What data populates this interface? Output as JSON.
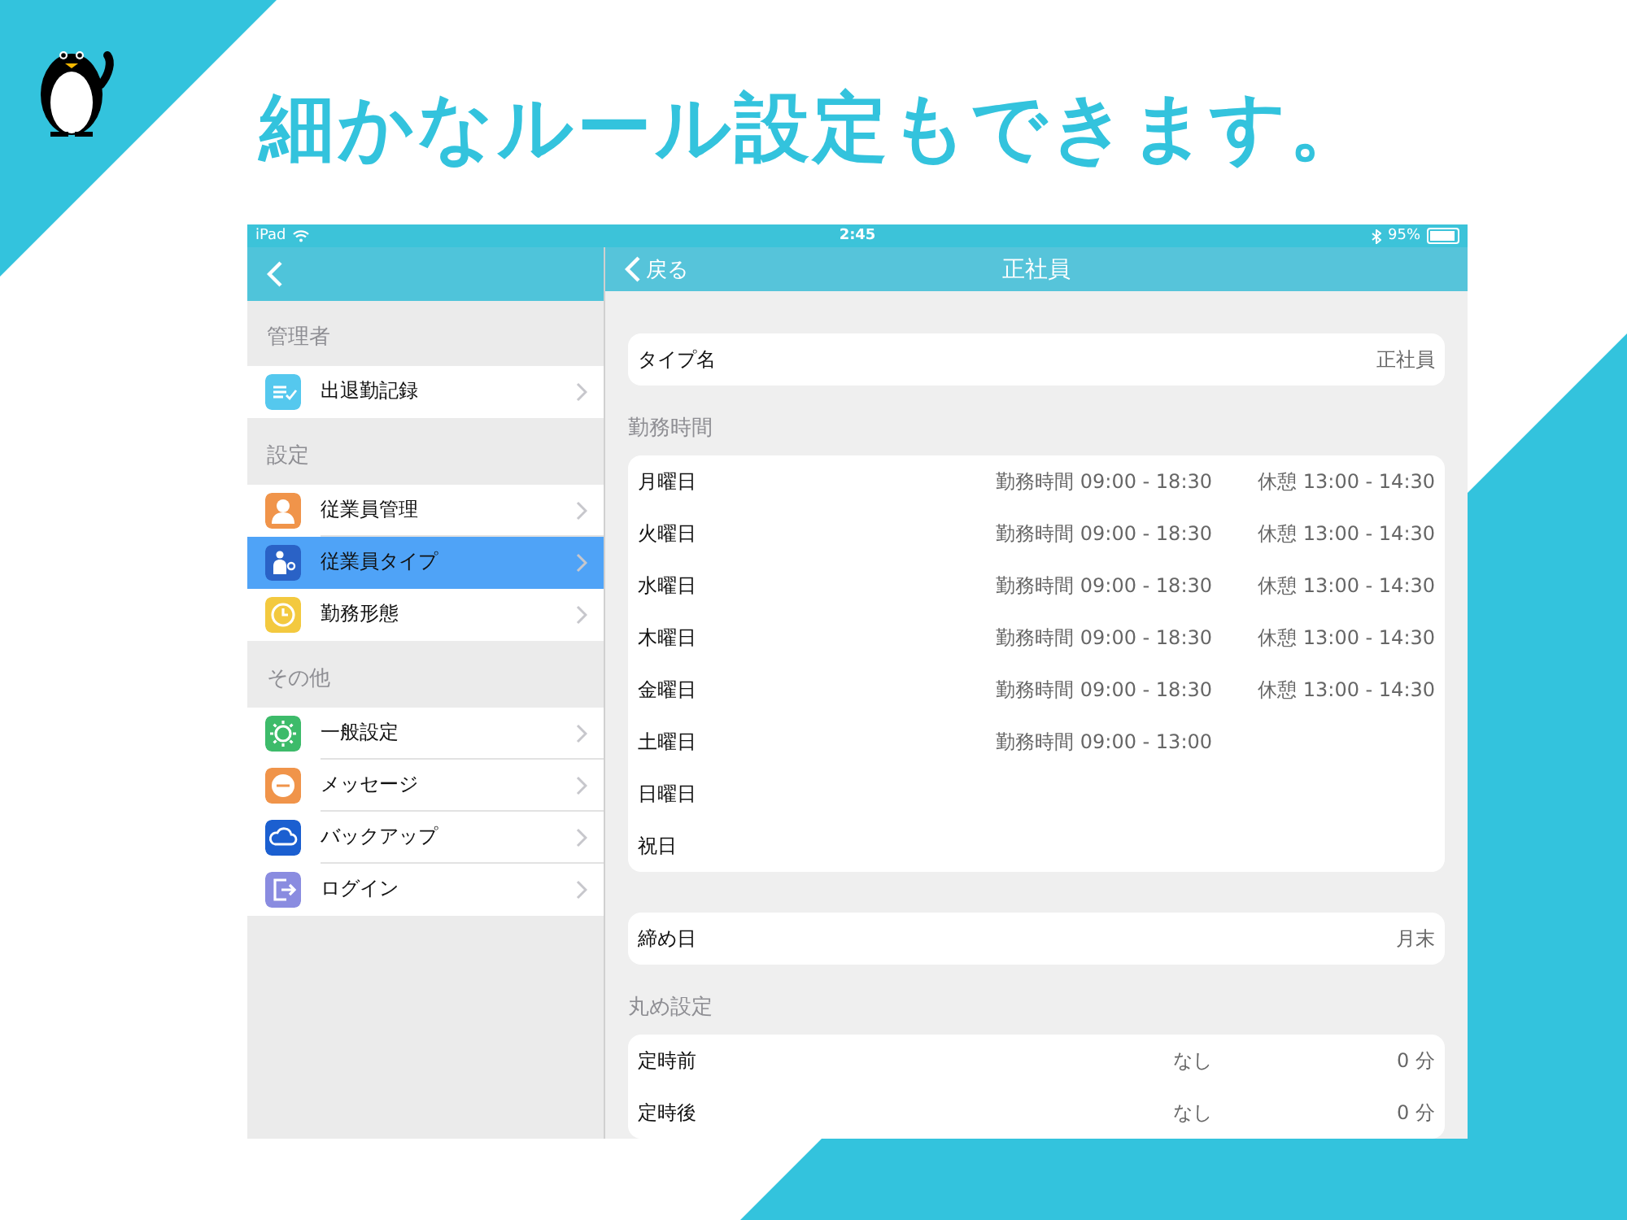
{
  "headline": "細かなルール設定もできます。",
  "status_bar": {
    "device": "iPad",
    "time": "2:45",
    "battery": {
      "reading": "95%",
      "level": 0.95
    }
  },
  "sidebar": {
    "sections": [
      {
        "title": "管理者",
        "items": [
          {
            "label": "出退勤記録",
            "color": "#55c8ee",
            "selected": false
          }
        ]
      },
      {
        "title": "設定",
        "items": [
          {
            "label": "従業員管理",
            "color": "#f0944a",
            "selected": false
          },
          {
            "label": "従業員タイプ",
            "color": "#2a62c6",
            "selected": true
          },
          {
            "label": "勤務形態",
            "color": "#f3c93f",
            "selected": false
          }
        ]
      },
      {
        "title": "その他",
        "items": [
          {
            "label": "一般設定",
            "color": "#3dbb6a",
            "selected": false
          },
          {
            "label": "メッセージ",
            "color": "#f0944a",
            "selected": false
          },
          {
            "label": "バックアップ",
            "color": "#1b5fd0",
            "selected": false
          },
          {
            "label": "ログイン",
            "color": "#8a8ce0",
            "selected": false
          }
        ]
      }
    ]
  },
  "detail": {
    "back": "戻る",
    "title": "正社員",
    "type_name": {
      "label": "タイプ名",
      "value": "正社員"
    },
    "work_hours": {
      "title": "勤務時間",
      "rows": [
        {
          "day": "月曜日",
          "hours": "勤務時間 09:00 - 18:30",
          "break": "休憩 13:00 - 14:30"
        },
        {
          "day": "火曜日",
          "hours": "勤務時間 09:00 - 18:30",
          "break": "休憩 13:00 - 14:30"
        },
        {
          "day": "水曜日",
          "hours": "勤務時間 09:00 - 18:30",
          "break": "休憩 13:00 - 14:30"
        },
        {
          "day": "木曜日",
          "hours": "勤務時間 09:00 - 18:30",
          "break": "休憩 13:00 - 14:30"
        },
        {
          "day": "金曜日",
          "hours": "勤務時間 09:00 - 18:30",
          "break": "休憩 13:00 - 14:30"
        },
        {
          "day": "土曜日",
          "hours": "勤務時間 09:00 - 13:00"
        },
        {
          "day": "日曜日"
        },
        {
          "day": "祝日"
        }
      ]
    },
    "closing_day": {
      "label": "締め日",
      "value": "月末"
    },
    "rounding": {
      "title": "丸め設定",
      "rows": [
        {
          "label": "定時前",
          "mode": "なし",
          "minutes": "0 分"
        },
        {
          "label": "定時後",
          "mode": "なし",
          "minutes": "0 分"
        }
      ]
    }
  }
}
